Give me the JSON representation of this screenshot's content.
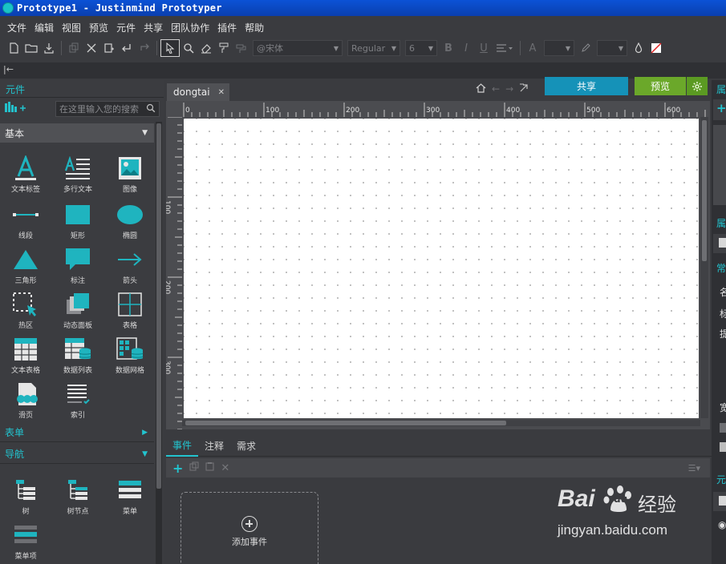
{
  "window": {
    "title": "Prototype1 - Justinmind Prototyper"
  },
  "menu": [
    "文件",
    "编辑",
    "视图",
    "预览",
    "元件",
    "共享",
    "团队协作",
    "插件",
    "帮助"
  ],
  "toolbar": {
    "font_name": "@宋体",
    "font_style": "Regular",
    "font_size": "6",
    "bold": "B",
    "italic": "I",
    "underline": "U",
    "text_color_label": "A"
  },
  "left_panel": {
    "title": "元件",
    "search_placeholder": "在这里输入您的搜索",
    "categories": {
      "basic": "基本",
      "forms": "表单",
      "nav": "导航"
    },
    "basic_items": [
      "文本标签",
      "多行文本",
      "图像",
      "线段",
      "矩形",
      "椭圆",
      "三角形",
      "标注",
      "箭头",
      "热区",
      "动态面板",
      "表格",
      "文本表格",
      "数据列表",
      "数据网格",
      "滑页",
      "索引"
    ],
    "nav_items": [
      "树",
      "树节点",
      "菜单",
      "菜单项"
    ]
  },
  "canvas": {
    "tab_label": "dongtai",
    "share_label": "共享",
    "preview_label": "预览",
    "ruler_h": [
      "0",
      "100",
      "200",
      "300",
      "400",
      "500",
      "600"
    ],
    "ruler_v": [
      "100",
      "200",
      "300"
    ]
  },
  "bottom_panel": {
    "tabs": [
      "事件",
      "注释",
      "需求"
    ],
    "add_event_label": "添加事件"
  },
  "watermark": {
    "brand": "Bai",
    "brand2": "du",
    "cn": "经验",
    "url": "jingyan.baidu.com"
  },
  "right_panel": {
    "labels": [
      "属",
      "属",
      "常",
      "名",
      "标",
      "提",
      "宽",
      "元"
    ]
  },
  "colors": {
    "accent": "#22c4cf",
    "share": "#1592b8",
    "preview": "#6ba82a",
    "titlebar": "#0b52d6"
  }
}
